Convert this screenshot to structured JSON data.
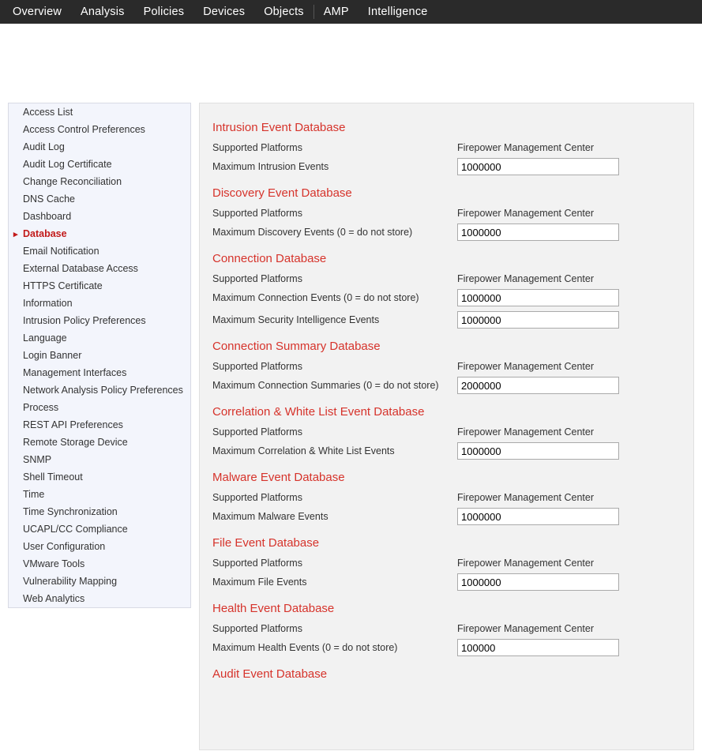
{
  "topnav": [
    "Overview",
    "Analysis",
    "Policies",
    "Devices",
    "Objects",
    "|",
    "AMP",
    "Intelligence"
  ],
  "sidebar": {
    "items": [
      "Access List",
      "Access Control Preferences",
      "Audit Log",
      "Audit Log Certificate",
      "Change Reconciliation",
      "DNS Cache",
      "Dashboard",
      "Database",
      "Email Notification",
      "External Database Access",
      "HTTPS Certificate",
      "Information",
      "Intrusion Policy Preferences",
      "Language",
      "Login Banner",
      "Management Interfaces",
      "Network Analysis Policy Preferences",
      "Process",
      "REST API Preferences",
      "Remote Storage Device",
      "SNMP",
      "Shell Timeout",
      "Time",
      "Time Synchronization",
      "UCAPL/CC Compliance",
      "User Configuration",
      "VMware Tools",
      "Vulnerability Mapping",
      "Web Analytics"
    ],
    "active_index": 7
  },
  "labels": {
    "supported_platforms": "Supported Platforms",
    "fmc": "Firepower Management Center"
  },
  "sections": [
    {
      "title": "Intrusion Event Database",
      "rows": [
        {
          "label": "Maximum Intrusion Events",
          "value": "1000000"
        }
      ]
    },
    {
      "title": "Discovery Event Database",
      "rows": [
        {
          "label": "Maximum Discovery Events (0 = do not store)",
          "value": "1000000"
        }
      ]
    },
    {
      "title": "Connection Database",
      "rows": [
        {
          "label": "Maximum Connection Events (0 = do not store)",
          "value": "1000000"
        },
        {
          "label": "Maximum Security Intelligence Events",
          "value": "1000000"
        }
      ]
    },
    {
      "title": "Connection Summary Database",
      "rows": [
        {
          "label": "Maximum Connection Summaries (0 = do not store)",
          "value": "2000000"
        }
      ]
    },
    {
      "title": "Correlation & White List Event Database",
      "rows": [
        {
          "label": "Maximum Correlation & White List Events",
          "value": "1000000"
        }
      ]
    },
    {
      "title": "Malware Event Database",
      "rows": [
        {
          "label": "Maximum Malware Events",
          "value": "1000000"
        }
      ]
    },
    {
      "title": "File Event Database",
      "rows": [
        {
          "label": "Maximum File Events",
          "value": "1000000"
        }
      ]
    },
    {
      "title": "Health Event Database",
      "rows": [
        {
          "label": "Maximum Health Events (0 = do not store)",
          "value": "100000"
        }
      ]
    },
    {
      "title": "Audit Event Database",
      "rows": []
    }
  ]
}
